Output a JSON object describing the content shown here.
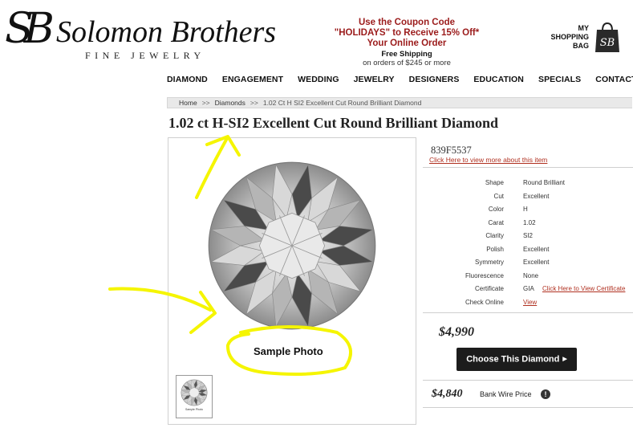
{
  "header": {
    "logo": {
      "monogram": "SB",
      "name": "Solomon Brothers",
      "subtitle": "FINE JEWELRY"
    },
    "promo": {
      "line1": "Use the Coupon Code",
      "line2": "\"HOLIDAYS\" to Receive 15% Off*",
      "line3": "Your Online Order",
      "line4": "Free Shipping",
      "line5": "on orders of $245 or more"
    },
    "bag": {
      "line1": "MY",
      "line2": "SHOPPING",
      "line3": "BAG",
      "icon": "shopping-bag-icon"
    }
  },
  "nav": {
    "items": [
      {
        "label": "DIAMOND"
      },
      {
        "label": "ENGAGEMENT"
      },
      {
        "label": "WEDDING"
      },
      {
        "label": "JEWELRY"
      },
      {
        "label": "DESIGNERS"
      },
      {
        "label": "EDUCATION"
      },
      {
        "label": "SPECIALS"
      },
      {
        "label": "CONTACT US"
      }
    ]
  },
  "breadcrumb": {
    "items": [
      "Home",
      "Diamonds",
      "1.02 Ct H SI2 Excellent Cut Round Brilliant Diamond"
    ],
    "separator": ">>"
  },
  "product": {
    "title": "1.02 ct H-SI2 Excellent Cut Round Brilliant Diamond",
    "image_caption": "Sample Photo",
    "thumb_caption": "Sample Photo",
    "stock_id": "839F5537",
    "more_link": "Click Here to view more about this item",
    "specs": [
      {
        "label": "Shape",
        "value": "Round Brilliant"
      },
      {
        "label": "Cut",
        "value": "Excellent"
      },
      {
        "label": "Color",
        "value": "H"
      },
      {
        "label": "Carat",
        "value": "1.02"
      },
      {
        "label": "Clarity",
        "value": "SI2"
      },
      {
        "label": "Polish",
        "value": "Excellent"
      },
      {
        "label": "Symmetry",
        "value": "Excellent"
      },
      {
        "label": "Fluorescence",
        "value": "None"
      },
      {
        "label": "Certificate",
        "value": "GIA",
        "extra": "Click Here to View Certificate"
      },
      {
        "label": "Check Online",
        "value": "View"
      }
    ],
    "price": "$4,990",
    "choose_button": "Choose This Diamond",
    "wire_price": "$4,840",
    "wire_label": "Bank Wire Price"
  },
  "colors": {
    "promo": "#9b1b1b",
    "link": "#b03020",
    "button_bg": "#1c1c1c",
    "annotation": "#f5f500"
  }
}
